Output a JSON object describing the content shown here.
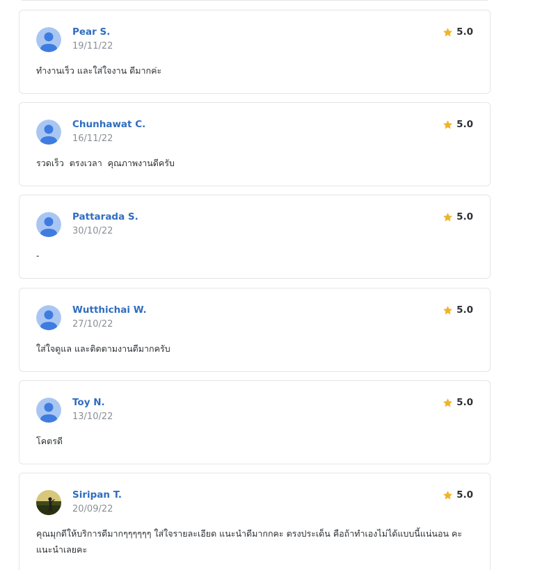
{
  "reviews": [
    {
      "name": "Pear S.",
      "date": "19/11/22",
      "score": "5.0",
      "comment": "ทำงานเร็ว และใส่ใจงาน ดีมากค่ะ",
      "avatar": "default-avatar"
    },
    {
      "name": "Chunhawat C.",
      "date": "16/11/22",
      "score": "5.0",
      "comment": "รวดเร็ว  ตรงเวลา  คุณภาพงานดีครับ",
      "avatar": "default-avatar"
    },
    {
      "name": "Pattarada S.",
      "date": "30/10/22",
      "score": "5.0",
      "comment": "-",
      "avatar": "default-avatar"
    },
    {
      "name": "Wutthichai W.",
      "date": "27/10/22",
      "score": "5.0",
      "comment": "ใส่ใจดูแล และติดตามงานดีมากครับ",
      "avatar": "default-avatar"
    },
    {
      "name": "Toy N.",
      "date": "13/10/22",
      "score": "5.0",
      "comment": "โคตรดี",
      "avatar": "default-avatar"
    },
    {
      "name": "Siripan T.",
      "date": "20/09/22",
      "score": "5.0",
      "comment": "คุณมุกดีให้บริการดีมากๆๆๆๆๆๆ ใส่ใจรายละเอียด แนะนำดีมากกคะ ตรงประเด็น คือถ้าทำเองไม่ได้แบบนี้แน่นอน คะ แนะนำเลยคะ",
      "avatar": "photo-avatar"
    }
  ],
  "colors": {
    "name": "#2f6dbf",
    "star": "#f0b429",
    "avatar_bg": "#a9c6f3",
    "avatar_fg": "#3f7ce0"
  }
}
